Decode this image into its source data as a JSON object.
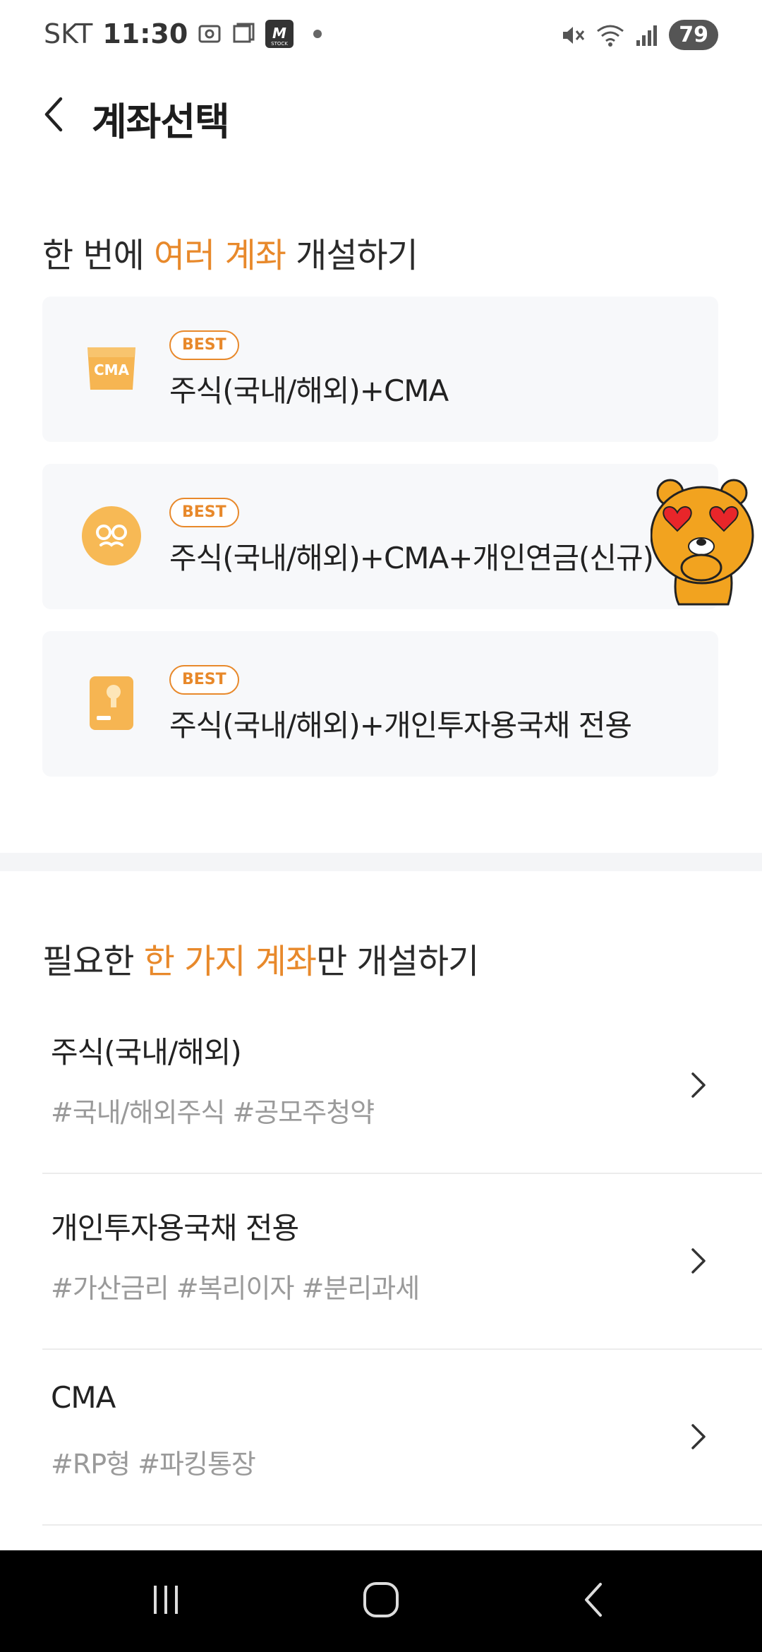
{
  "status_bar": {
    "carrier": "SKT",
    "time": "11:30",
    "battery": "79",
    "icons": [
      "screenshot-icon",
      "window-icon",
      "m-stock-icon",
      "mute-icon",
      "wifi-icon",
      "signal-icon"
    ]
  },
  "header": {
    "title": "계좌선택",
    "back_icon": "chevron-left-icon"
  },
  "bundle_section": {
    "title_pre": "한 번에 ",
    "title_accent": "여러 계좌",
    "title_post": " 개설하기",
    "accent_color": "#e8892b",
    "cards": [
      {
        "badge": "BEST",
        "label": "주식(국내/해외)+CMA",
        "icon": "cma-icon",
        "icon_text": "CMA"
      },
      {
        "badge": "BEST",
        "label": "주식(국내/해외)+CMA+개인연금(신규)",
        "icon": "pension-icon"
      },
      {
        "badge": "BEST",
        "label": "주식(국내/해외)+개인투자용국채 전용",
        "icon": "bond-book-icon"
      }
    ]
  },
  "single_section": {
    "title_pre": "필요한 ",
    "title_accent": "한 가지 계좌",
    "title_post": "만 개설하기",
    "items": [
      {
        "title": "주식(국내/해외)",
        "tags": "#국내/해외주식 #공모주청약"
      },
      {
        "title": "개인투자용국채 전용",
        "tags": "#가산금리 #복리이자 #분리과세"
      },
      {
        "title": "CMA",
        "tags": "#RP형 #파킹통장"
      }
    ]
  },
  "nav_bar": {
    "buttons": [
      "recent-apps-icon",
      "home-icon",
      "back-icon"
    ]
  }
}
